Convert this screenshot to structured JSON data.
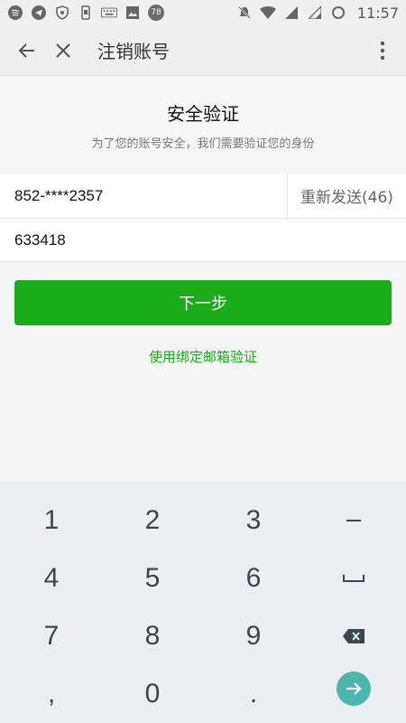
{
  "status_bar": {
    "time": "11:57",
    "notification_count": "78",
    "left_icons": [
      "spotify-icon",
      "telegram-icon",
      "vpn-shield-icon",
      "sim-icon",
      "keyboard-icon",
      "image-icon"
    ],
    "right_icons": [
      "notifications-off-icon",
      "wifi-icon",
      "signal-icon",
      "signal-icon",
      "battery-icon"
    ]
  },
  "app_bar": {
    "title": "注销账号",
    "back_icon": "arrow-left-icon",
    "close_icon": "close-icon",
    "more_icon": "more-vertical-icon"
  },
  "header": {
    "title": "安全验证",
    "subtitle": "为了您的账号安全，我们需要验证您的身份"
  },
  "form": {
    "phone": "852-****2357",
    "resend_label": "重新发送(46)",
    "code_value": "633418"
  },
  "actions": {
    "next_label": "下一步",
    "email_link": "使用绑定邮箱验证"
  },
  "keyboard": {
    "keys": [
      [
        "1",
        "2",
        "3",
        "−"
      ],
      [
        "4",
        "5",
        "6",
        "␣"
      ],
      [
        "7",
        "8",
        "9",
        "⌫"
      ],
      [
        ",",
        "0",
        ".",
        "→"
      ]
    ]
  },
  "colors": {
    "accent_green": "#1aad19",
    "keyboard_bg": "#eceff1",
    "go_key": "#4db6ac"
  }
}
